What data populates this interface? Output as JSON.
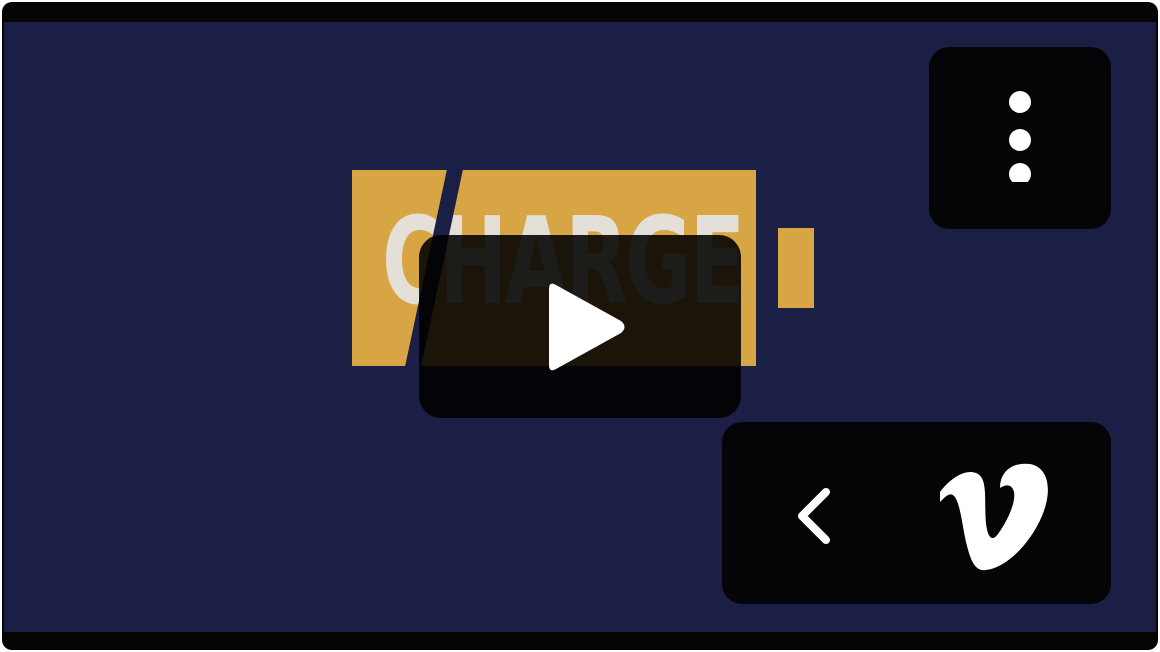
{
  "player": {
    "thumbnail_logo_text": "CHARGE",
    "colors": {
      "background": "#1b1f45",
      "logo_gold": "#d8a545",
      "logo_text": "#e4e0d8",
      "control_bg": "#050507",
      "icon": "#ffffff"
    }
  },
  "controls": {
    "play": {
      "icon": "play-icon"
    },
    "menu": {
      "icon": "more-vertical-icon"
    },
    "back": {
      "icon": "chevron-left-icon"
    },
    "brand": {
      "icon": "vimeo-icon"
    }
  }
}
